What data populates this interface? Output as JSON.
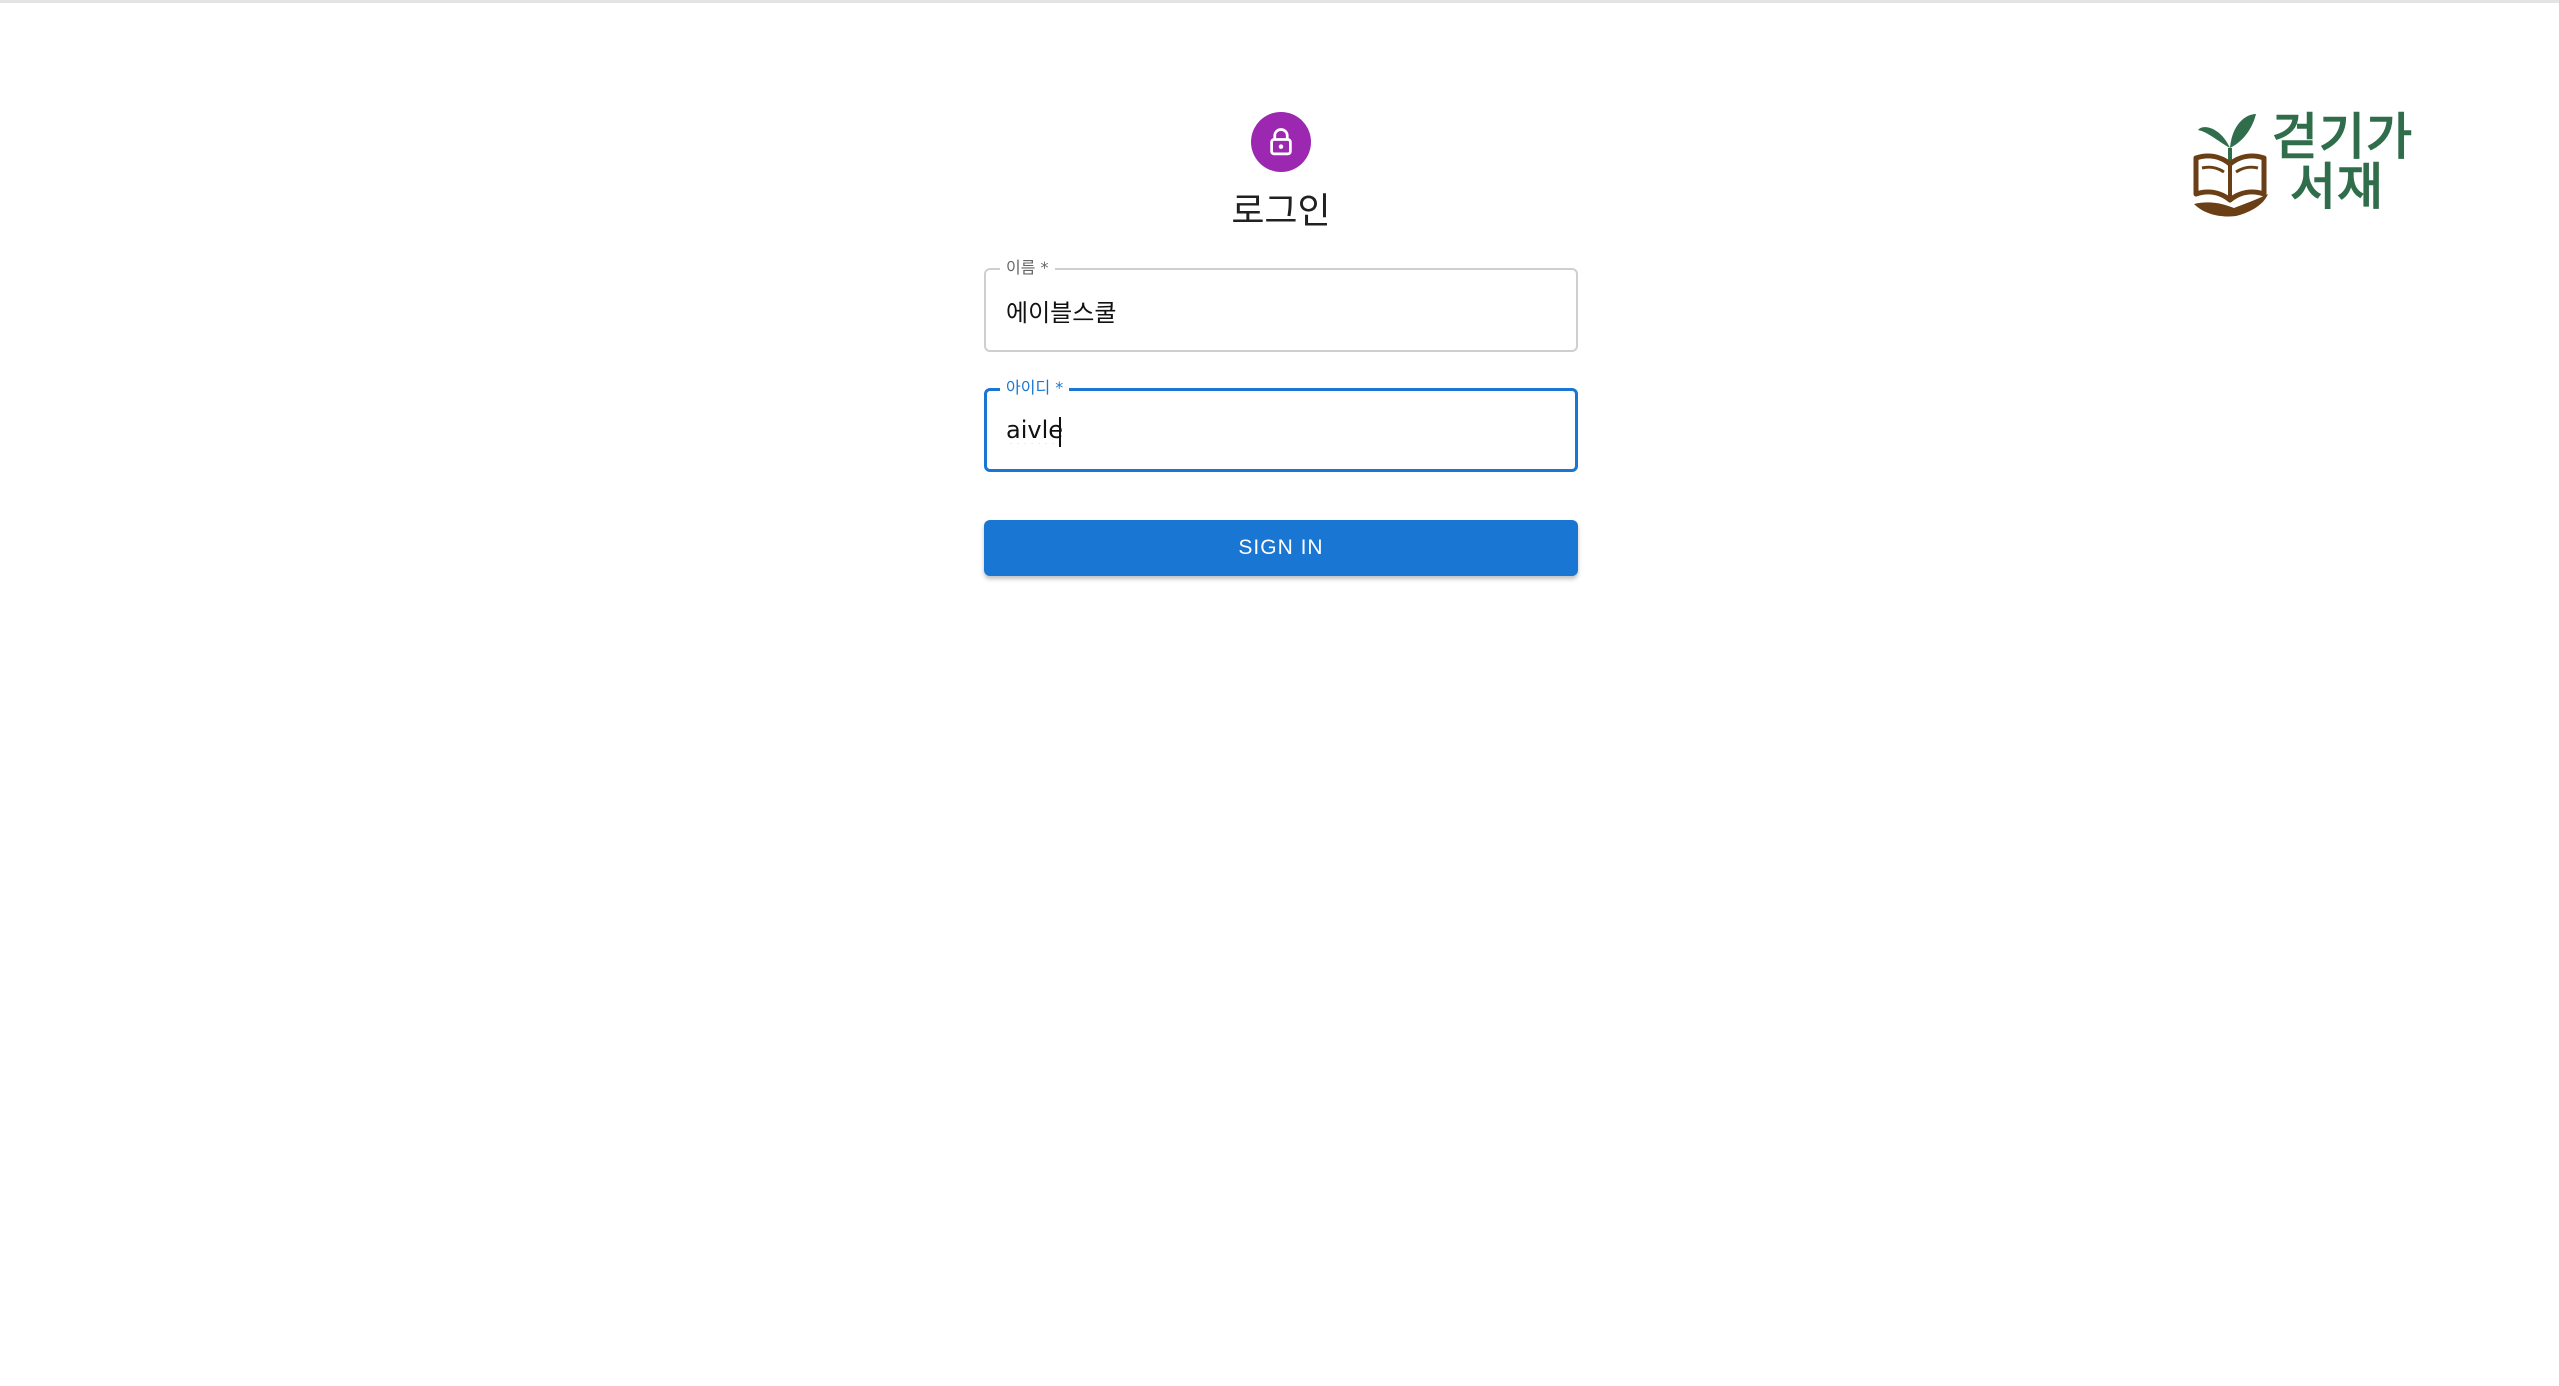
{
  "page": {
    "title": "로그인"
  },
  "icons": {
    "avatar": "lock-icon",
    "logo": "book-sprout-icon"
  },
  "colors": {
    "avatar_bg": "#9c27b0",
    "primary": "#1976d2",
    "logo_green": "#2f6d4b",
    "logo_brown": "#6b3f16"
  },
  "brand": {
    "line1": "걷기가",
    "line2": "서재"
  },
  "form": {
    "name_label": "이름 *",
    "name_value": "에이블스쿨",
    "id_label": "아이디 *",
    "id_value": "aivle",
    "submit_label": "SIGN IN"
  }
}
